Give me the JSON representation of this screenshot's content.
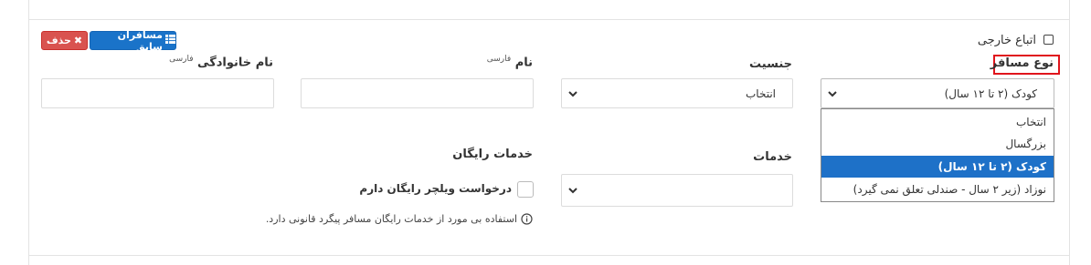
{
  "buttons": {
    "delete_label": "حذف",
    "previous_passengers_label": "مسافران سابق"
  },
  "foreign_checkbox": {
    "label": "اتباع خارجی",
    "checked": false
  },
  "passenger_type": {
    "label": "نوع مسافر",
    "selected": "کودک (۲ تا ۱۲ سال)",
    "options": [
      "انتخاب",
      "بزرگسال",
      "کودک (۲ تا ۱۲ سال)",
      "نوزاد (زیر ۲ سال - صندلی تعلق نمی گیرد)"
    ]
  },
  "gender": {
    "label": "جنسیت",
    "selected": "انتخاب"
  },
  "first_name": {
    "label": "نام",
    "hint": "فارسی",
    "value": ""
  },
  "last_name": {
    "label": "نام خانوادگی",
    "hint": "فارسی",
    "value": ""
  },
  "services": {
    "label": "خدمات",
    "selected": ""
  },
  "free_services": {
    "label": "خدمات رایگان",
    "wheelchair_label": "درخواست ویلچر رایگان دارم",
    "wheelchair_checked": false,
    "info": "استفاده بی مورد از خدمات رایگان مسافر پیگرد قانونی دارد."
  }
}
